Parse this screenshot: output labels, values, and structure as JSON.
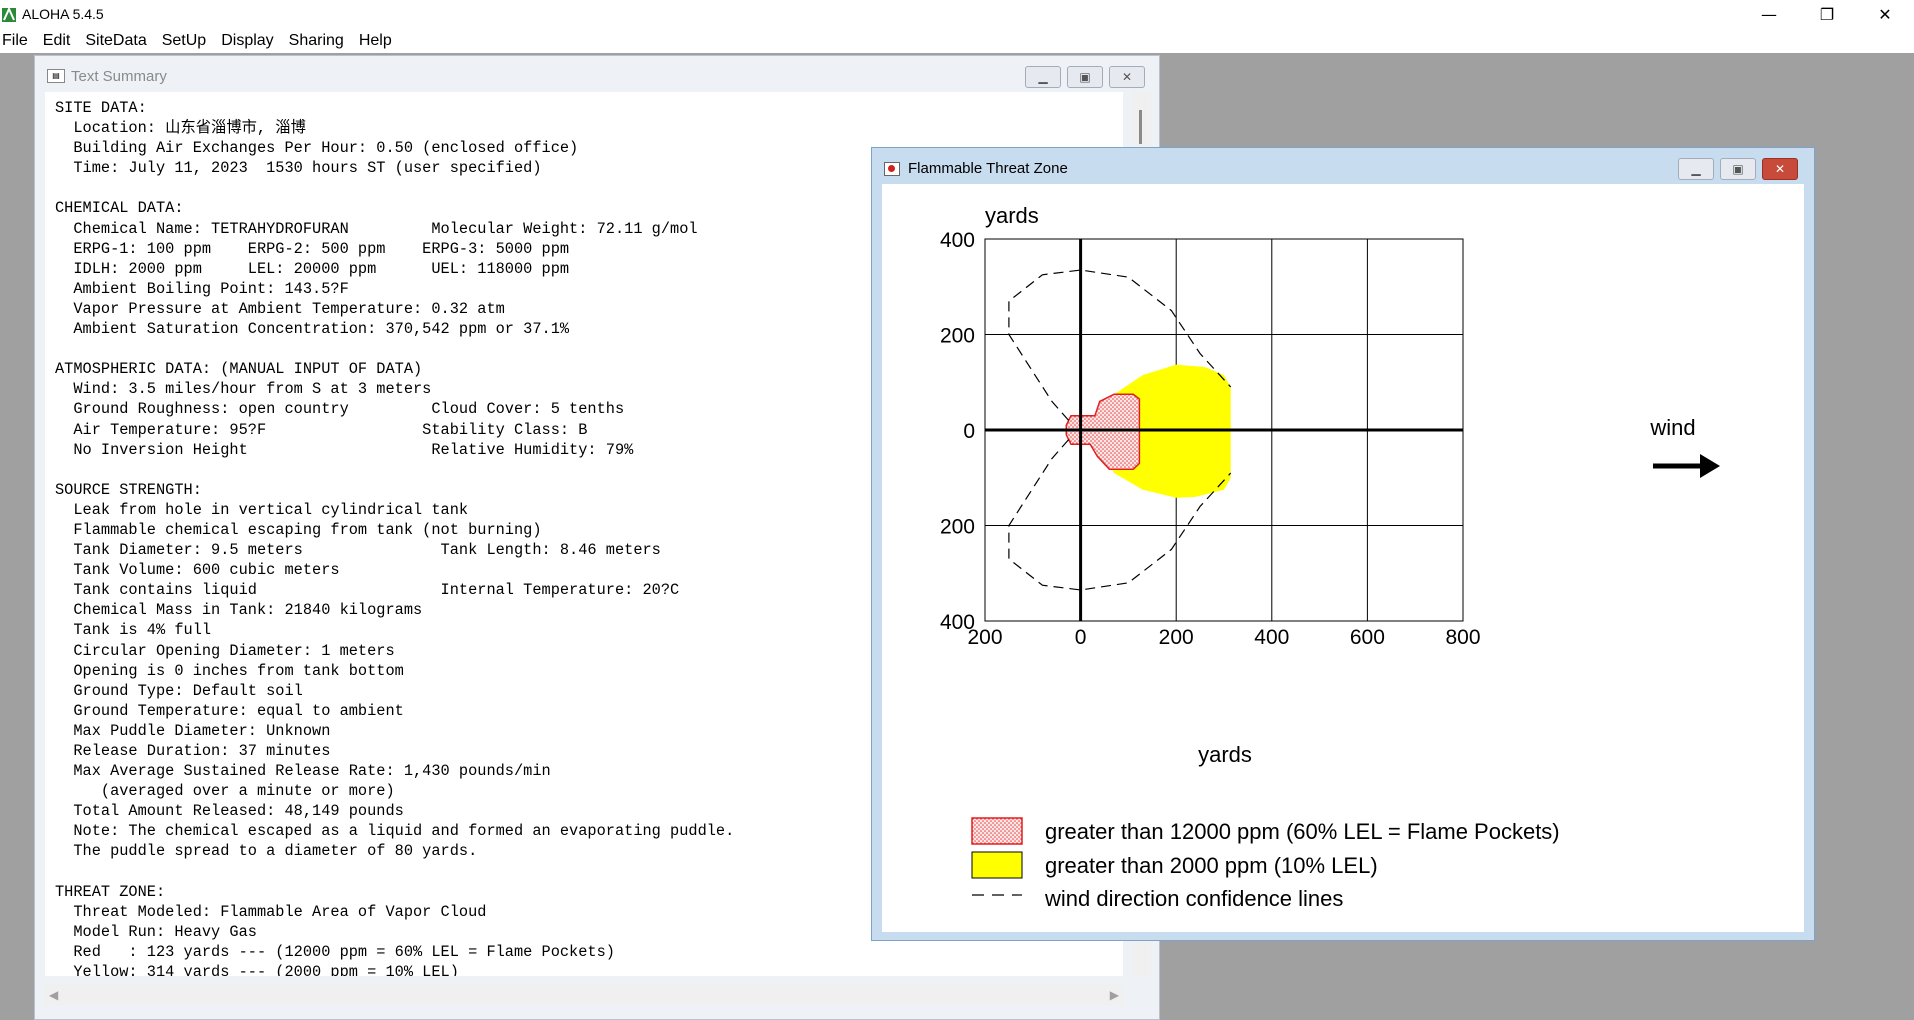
{
  "app": {
    "title": "ALOHA 5.4.5",
    "window_controls": [
      "—",
      "❐",
      "✕"
    ]
  },
  "menu": [
    "File",
    "Edit",
    "SiteData",
    "SetUp",
    "Display",
    "Sharing",
    "Help"
  ],
  "text_summary": {
    "title": "Text Summary",
    "lines": [
      "SITE DATA:",
      "  Location: 山东省淄博市, 淄博",
      "  Building Air Exchanges Per Hour: 0.50 (enclosed office)",
      "  Time: July 11, 2023  1530 hours ST (user specified)",
      "",
      "CHEMICAL DATA:",
      "  Chemical Name: TETRAHYDROFURAN         Molecular Weight: 72.11 g/mol",
      "  ERPG-1: 100 ppm    ERPG-2: 500 ppm    ERPG-3: 5000 ppm",
      "  IDLH: 2000 ppm     LEL: 20000 ppm      UEL: 118000 ppm",
      "  Ambient Boiling Point: 143.5?F",
      "  Vapor Pressure at Ambient Temperature: 0.32 atm",
      "  Ambient Saturation Concentration: 370,542 ppm or 37.1%",
      "",
      "ATMOSPHERIC DATA: (MANUAL INPUT OF DATA)",
      "  Wind: 3.5 miles/hour from S at 3 meters",
      "  Ground Roughness: open country         Cloud Cover: 5 tenths",
      "  Air Temperature: 95?F                 Stability Class: B",
      "  No Inversion Height                    Relative Humidity: 79%",
      "",
      "SOURCE STRENGTH:",
      "  Leak from hole in vertical cylindrical tank",
      "  Flammable chemical escaping from tank (not burning)",
      "  Tank Diameter: 9.5 meters               Tank Length: 8.46 meters",
      "  Tank Volume: 600 cubic meters",
      "  Tank contains liquid                    Internal Temperature: 20?C",
      "  Chemical Mass in Tank: 21840 kilograms",
      "  Tank is 4% full",
      "  Circular Opening Diameter: 1 meters",
      "  Opening is 0 inches from tank bottom",
      "  Ground Type: Default soil",
      "  Ground Temperature: equal to ambient",
      "  Max Puddle Diameter: Unknown",
      "  Release Duration: 37 minutes",
      "  Max Average Sustained Release Rate: 1,430 pounds/min",
      "     (averaged over a minute or more)",
      "  Total Amount Released: 48,149 pounds",
      "  Note: The chemical escaped as a liquid and formed an evaporating puddle.",
      "  The puddle spread to a diameter of 80 yards.",
      "",
      "THREAT ZONE:",
      "  Threat Modeled: Flammable Area of Vapor Cloud",
      "  Model Run: Heavy Gas",
      "  Red   : 123 yards --- (12000 ppm = 60% LEL = Flame Pockets)",
      "  Yellow: 314 yards --- (2000 ppm = 10% LEL)"
    ]
  },
  "threat_zone": {
    "title": "Flammable Threat Zone",
    "wind_label": "wind",
    "legend": [
      {
        "label": "greater than 12000 ppm (60% LEL = Flame Pockets)",
        "color": "#ff9a9a"
      },
      {
        "label": "greater than 2000 ppm (10% LEL)",
        "color": "#ffff00"
      },
      {
        "label": "wind direction confidence lines",
        "color": "#000000"
      }
    ],
    "chart_data": {
      "type": "area",
      "xlabel": "yards",
      "ylabel": "yards",
      "xlim": [
        -200,
        800
      ],
      "ylim": [
        -400,
        400
      ],
      "x_ticks": [
        "200",
        "0",
        "200",
        "400",
        "600",
        "800"
      ],
      "y_ticks": [
        "400",
        "200",
        "0",
        "200",
        "400"
      ],
      "grid": true,
      "zones": [
        {
          "name": "Red",
          "max_downwind_yards": 123,
          "concentration": "12000 ppm"
        },
        {
          "name": "Yellow",
          "max_downwind_yards": 314,
          "concentration": "2000 ppm"
        }
      ]
    }
  }
}
